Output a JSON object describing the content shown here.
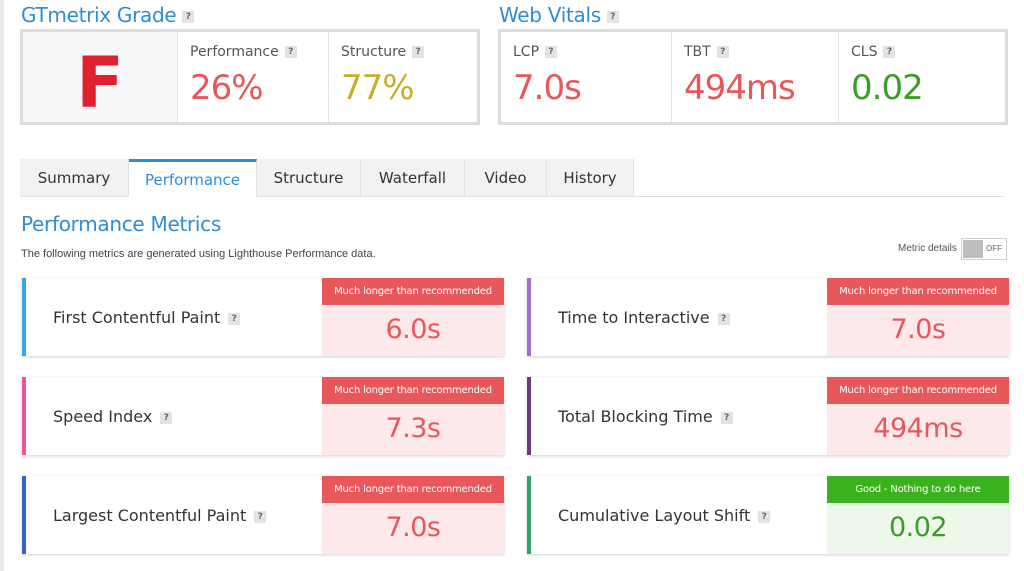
{
  "colors": {
    "accent": "#2f8dd6",
    "bad": "#e8575a",
    "warn": "#c9ae2b",
    "good": "#3a9f27",
    "bad_badge_bg": "#e8575a",
    "bad_area_bg": "#fde9e9",
    "good_badge_bg": "#3ab21d",
    "good_area_bg": "#edf7ea"
  },
  "grade": {
    "title": "GTmetrix Grade",
    "letter": "F",
    "performance_label": "Performance",
    "performance_value": "26%",
    "structure_label": "Structure",
    "structure_value": "77%"
  },
  "vitals": {
    "title": "Web Vitals",
    "lcp_label": "LCP",
    "lcp_value": "7.0s",
    "tbt_label": "TBT",
    "tbt_value": "494ms",
    "cls_label": "CLS",
    "cls_value": "0.02"
  },
  "help_icon": "?",
  "tabs": [
    "Summary",
    "Performance",
    "Structure",
    "Waterfall",
    "Video",
    "History"
  ],
  "active_tab": "Performance",
  "metrics_section": {
    "title": "Performance Metrics",
    "description": "The following metrics are generated using Lighthouse Performance data.",
    "details_label": "Metric details",
    "toggle_state": "OFF"
  },
  "metrics": [
    {
      "name": "First Contentful Paint",
      "value": "6.0s",
      "badge": "Much longer than recommended",
      "status": "bad",
      "bar_color": "#35a5e4"
    },
    {
      "name": "Time to Interactive",
      "value": "7.0s",
      "badge": "Much longer than recommended",
      "status": "bad",
      "bar_color": "#a46ec9"
    },
    {
      "name": "Speed Index",
      "value": "7.3s",
      "badge": "Much longer than recommended",
      "status": "bad",
      "bar_color": "#e9569a"
    },
    {
      "name": "Total Blocking Time",
      "value": "494ms",
      "badge": "Much longer than recommended",
      "status": "bad",
      "bar_color": "#6d3b7a"
    },
    {
      "name": "Largest Contentful Paint",
      "value": "7.0s",
      "badge": "Much longer than recommended",
      "status": "bad",
      "bar_color": "#3a63c9"
    },
    {
      "name": "Cumulative Layout Shift",
      "value": "0.02",
      "badge": "Good - Nothing to do here",
      "status": "good",
      "bar_color": "#2fa36b"
    }
  ]
}
